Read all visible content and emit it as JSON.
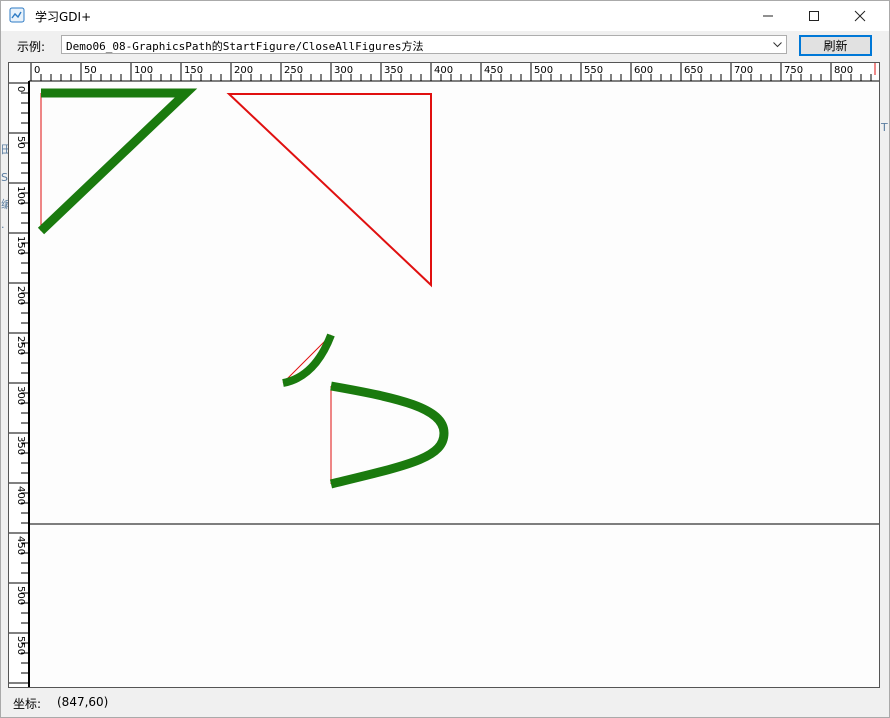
{
  "window": {
    "title": "学习GDI+",
    "controls": {
      "minimize": "—",
      "maximize": "☐",
      "close": "✕"
    }
  },
  "toolbar": {
    "example_label": "示例:",
    "example_value": "Demo06_08-GraphicsPath的StartFigure/CloseAllFigures方法",
    "refresh_label": "刷新"
  },
  "ruler": {
    "h_ticks": [
      "0",
      "50",
      "100",
      "150",
      "200",
      "250",
      "300",
      "350",
      "400",
      "450",
      "500",
      "550",
      "600",
      "650",
      "700",
      "750",
      "800"
    ],
    "v_ticks": [
      "0",
      "50",
      "100",
      "150",
      "200",
      "250",
      "300",
      "350",
      "400",
      "450",
      "500",
      "550"
    ]
  },
  "canvas": {
    "colors": {
      "thick_path": "#1a7a0e",
      "thin_path": "#e01010"
    }
  },
  "status": {
    "label": "坐标:",
    "value": "(847,60)"
  },
  "colors": {
    "accent": "#0078d7",
    "background": "#f0f0f0"
  }
}
